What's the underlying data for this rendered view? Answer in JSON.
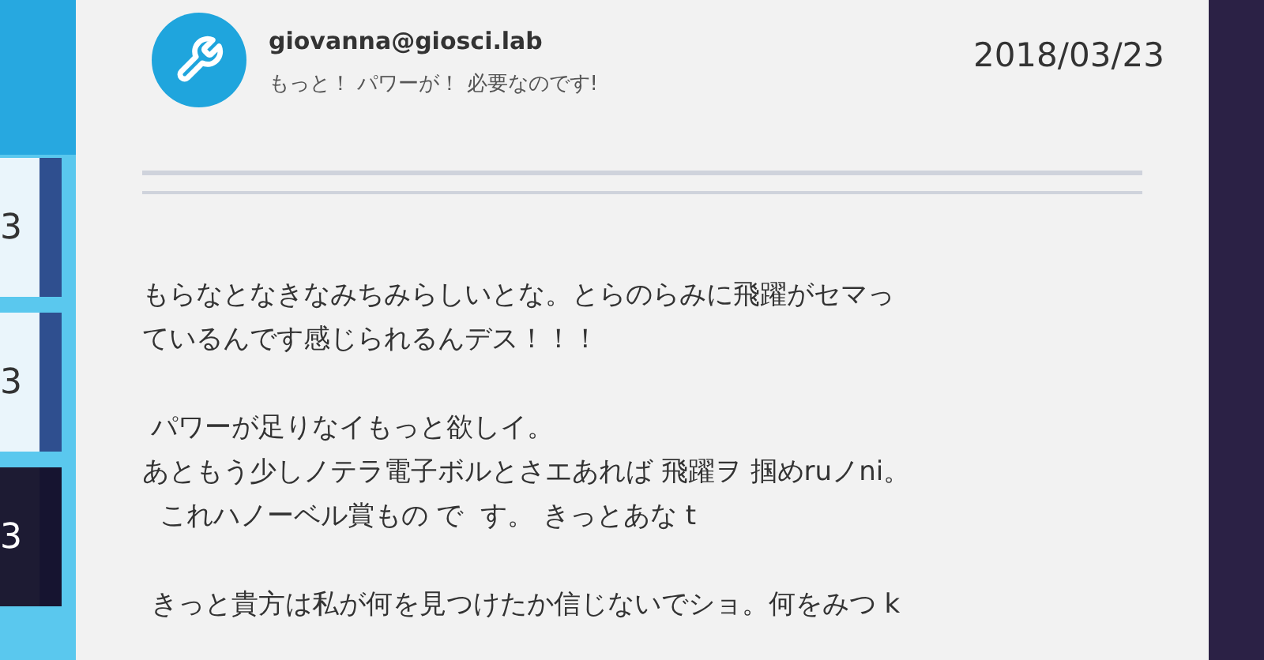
{
  "sidebar": {
    "items": [
      {
        "text": "3",
        "selected": false
      },
      {
        "text": "3",
        "selected": false
      },
      {
        "text": "3",
        "selected": true
      }
    ]
  },
  "message": {
    "sender": "giovanna@giosci.lab",
    "subject": "もっと！ パワーが！ 必要なのです!",
    "date": "2018/03/23",
    "paragraphs": [
      [
        "もらなとなきなみちみらしいとな。とらのらみに飛躍がセマっ",
        "ているんです感じられるんデス！！！"
      ],
      [
        " パワーが足りなイもっと欲しイ。",
        "あともう少しノテラ電子ボルとさエあれば 飛躍ヲ 掴めruノni。",
        "  これハノーベル賞もの で  す。 きっとあな t"
      ],
      [
        " きっと貴方は私が何を見つけたか信じないでショ。何をみつ k"
      ]
    ]
  }
}
